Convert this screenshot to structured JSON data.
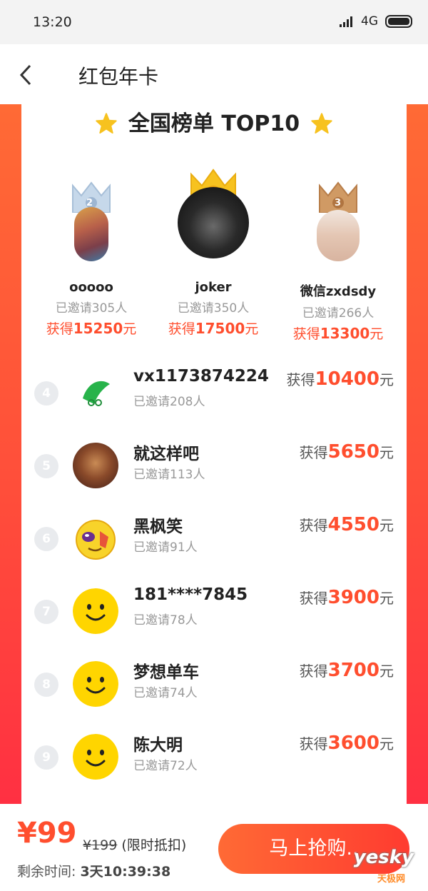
{
  "status": {
    "time": "13:20",
    "network": "4G"
  },
  "header": {
    "title": "红包年卡"
  },
  "board": {
    "title": "全国榜单 TOP10"
  },
  "podium": [
    {
      "rank": "2",
      "name": "ooooo",
      "invited": "已邀请305人",
      "earn_prefix": "获得",
      "amount": "15250",
      "earn_suffix": "元"
    },
    {
      "rank": "1",
      "name": "joker",
      "invited": "已邀请350人",
      "earn_prefix": "获得",
      "amount": "17500",
      "earn_suffix": "元"
    },
    {
      "rank": "3",
      "name": "微信zxdsdy",
      "invited": "已邀请266人",
      "earn_prefix": "获得",
      "amount": "13300",
      "earn_suffix": "元"
    }
  ],
  "list": [
    {
      "rank": "4",
      "name": "vx1173874224",
      "invited": "已邀请208人",
      "earn_prefix": "获得",
      "amount": "10400",
      "earn_suffix": "元",
      "avatar": "peapod-icon"
    },
    {
      "rank": "5",
      "name": "就这样吧",
      "invited": "已邀请113人",
      "earn_prefix": "获得",
      "amount": "5650",
      "earn_suffix": "元",
      "avatar": "photo"
    },
    {
      "rank": "6",
      "name": "黑枫笑",
      "invited": "已邀请91人",
      "earn_prefix": "获得",
      "amount": "4550",
      "earn_suffix": "元",
      "avatar": "emoji-sunglasses-icon"
    },
    {
      "rank": "7",
      "name": "181****7845",
      "invited": "已邀请78人",
      "earn_prefix": "获得",
      "amount": "3900",
      "earn_suffix": "元",
      "avatar": "smiley-icon"
    },
    {
      "rank": "8",
      "name": "梦想单车",
      "invited": "已邀请74人",
      "earn_prefix": "获得",
      "amount": "3700",
      "earn_suffix": "元",
      "avatar": "smiley-icon"
    },
    {
      "rank": "9",
      "name": "陈大明",
      "invited": "已邀请72人",
      "earn_prefix": "获得",
      "amount": "3600",
      "earn_suffix": "元",
      "avatar": "smiley-icon"
    }
  ],
  "footer": {
    "price": "¥99",
    "original_price": "¥199",
    "discount_note": "(限时抵扣)",
    "remaining_label": "剩余时间:",
    "remaining_value": "3天10:39:38",
    "buy_label": "马上抢购..",
    "watermark": "yesky",
    "watermark_sub": "天极网"
  },
  "colors": {
    "accent": "#ff4e2e",
    "gold": "#f7c21f",
    "silver": "#b9cfe6",
    "bronze": "#c9905a"
  }
}
